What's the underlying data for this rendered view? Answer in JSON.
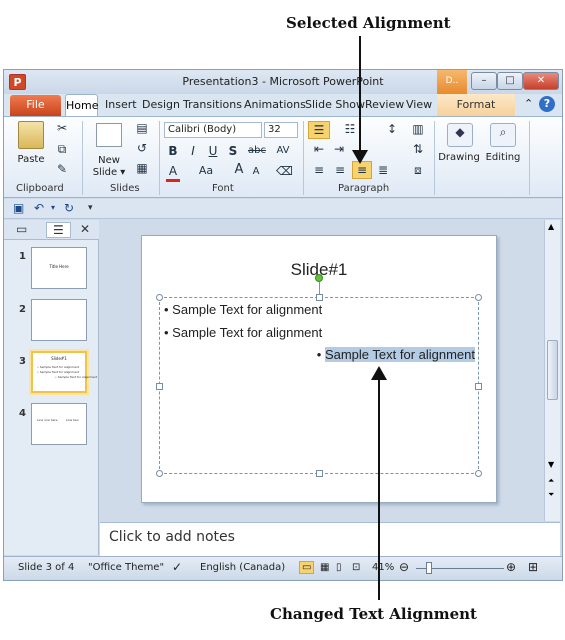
{
  "annotations": {
    "top": "Selected Alignment",
    "bottom": "Changed Text Alignment"
  },
  "window": {
    "app_icon": "P",
    "title": "Presentation3 - Microsoft PowerPoint",
    "context_label": "D..",
    "controls": [
      "–",
      "□",
      "✕"
    ]
  },
  "tabs": {
    "file": "File",
    "items": [
      "Home",
      "Insert",
      "Design",
      "Transitions",
      "Animations",
      "Slide Show",
      "Review",
      "View"
    ],
    "context": "Format"
  },
  "ribbon": {
    "groups": [
      "Clipboard",
      "Slides",
      "Font",
      "Paragraph",
      "Drawing",
      "Editing"
    ],
    "paste": "Paste",
    "new_slide": [
      "New",
      "Slide ▾"
    ],
    "font_name": "Calibri (Body)",
    "font_size": "32",
    "font_buttons": [
      "B",
      "I",
      "U",
      "S",
      "abc",
      "AV",
      "A",
      "Aa",
      "A",
      "A"
    ],
    "drawing": "Drawing",
    "editing": "Editing"
  },
  "slides_pane": {
    "thumbnails": [
      {
        "number": "1",
        "title": "Title Here",
        "lines": []
      },
      {
        "number": "2",
        "title": "",
        "lines": []
      },
      {
        "number": "3",
        "title": "Slide#1",
        "lines": [
          "• Sample Text for alignment",
          "• Sample Text for alignment",
          "• Sample Text for alignment"
        ]
      },
      {
        "number": "4",
        "title": "",
        "lines": [
          "Line one here",
          "Line two"
        ]
      }
    ]
  },
  "slide": {
    "title": "Slide#1",
    "bullets": [
      {
        "text": "Sample Text for alignment",
        "align": "left"
      },
      {
        "text": "Sample Text for alignment",
        "align": "left"
      },
      {
        "text": "Sample Text for alignment",
        "align": "right"
      }
    ]
  },
  "notes": {
    "placeholder": "Click to add notes"
  },
  "statusbar": {
    "slide_info": "Slide 3 of 4",
    "theme": "\"Office Theme\"",
    "language": "English (Canada)",
    "zoom": "41%"
  },
  "colors": {
    "accent_file": "#c9431c",
    "highlight": "#b4cbe6",
    "selected_button": "#f7d36f"
  }
}
